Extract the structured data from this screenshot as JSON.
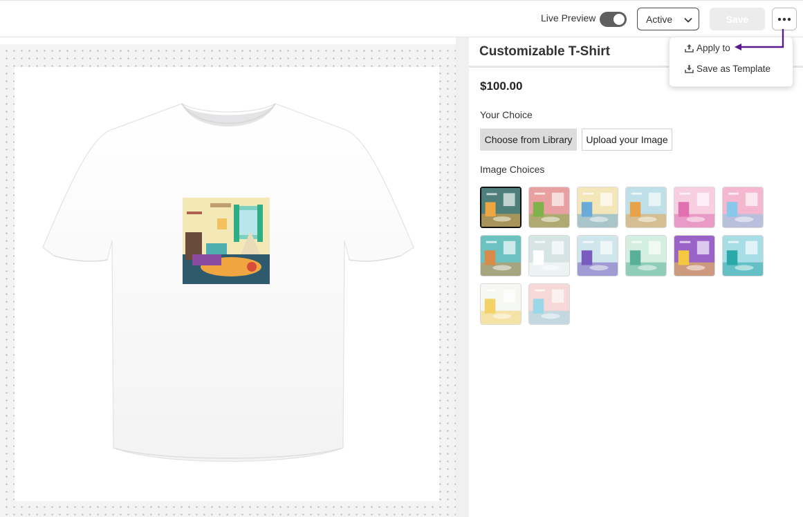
{
  "toolbar": {
    "live_preview_label": "Live Preview",
    "live_preview_on": true,
    "status_value": "Active",
    "save_label": "Save",
    "more_icon": "ellipsis-icon"
  },
  "menu": {
    "items": [
      {
        "label": "Apply to",
        "icon": "upload-icon"
      },
      {
        "label": "Save as Template",
        "icon": "download-icon"
      }
    ]
  },
  "product": {
    "title": "Customizable T-Shirt",
    "price": "$100.00",
    "choice_label": "Your Choice",
    "choose_library_label": "Choose from Library",
    "upload_label": "Upload your Image",
    "image_choices_label": "Image Choices",
    "selected_index": 0,
    "thumbnails": [
      {
        "name": "kids-room-teepee",
        "bg": "#4f7f7a",
        "accent": "#f0a640"
      },
      {
        "name": "pink-room-desk",
        "bg": "#e9a0a0",
        "accent": "#7fb24b"
      },
      {
        "name": "window-toy-room",
        "bg": "#f3e6b8",
        "accent": "#6aaad8"
      },
      {
        "name": "blue-room-shelves",
        "bg": "#bfe0e8",
        "accent": "#e8a24a"
      },
      {
        "name": "pink-nursery",
        "bg": "#f7cfe0",
        "accent": "#e070b0"
      },
      {
        "name": "pink-window-room",
        "bg": "#f4b7cf",
        "accent": "#88c8e8"
      },
      {
        "name": "teal-study-room",
        "bg": "#6cc2c0",
        "accent": "#d98c4a"
      },
      {
        "name": "grey-nursery",
        "bg": "#d6e4e4",
        "accent": "#ffffff"
      },
      {
        "name": "bunting-room",
        "bg": "#cfe6ec",
        "accent": "#7a5cc0"
      },
      {
        "name": "green-playroom",
        "bg": "#d4efe2",
        "accent": "#58b098"
      },
      {
        "name": "purple-bedroom",
        "bg": "#9a63c8",
        "accent": "#f5c842"
      },
      {
        "name": "teal-toy-room",
        "bg": "#a8dde6",
        "accent": "#2ba8a8"
      },
      {
        "name": "pastel-nursery",
        "bg": "#f4f7f2",
        "accent": "#f4d26a"
      },
      {
        "name": "blush-nursery",
        "bg": "#f7d8d8",
        "accent": "#9ad8e8"
      }
    ]
  },
  "colors": {
    "toggle_on": "#5f5f5f",
    "callout_arrow": "#5a1a8c",
    "save_disabled_bg": "#ececec"
  }
}
